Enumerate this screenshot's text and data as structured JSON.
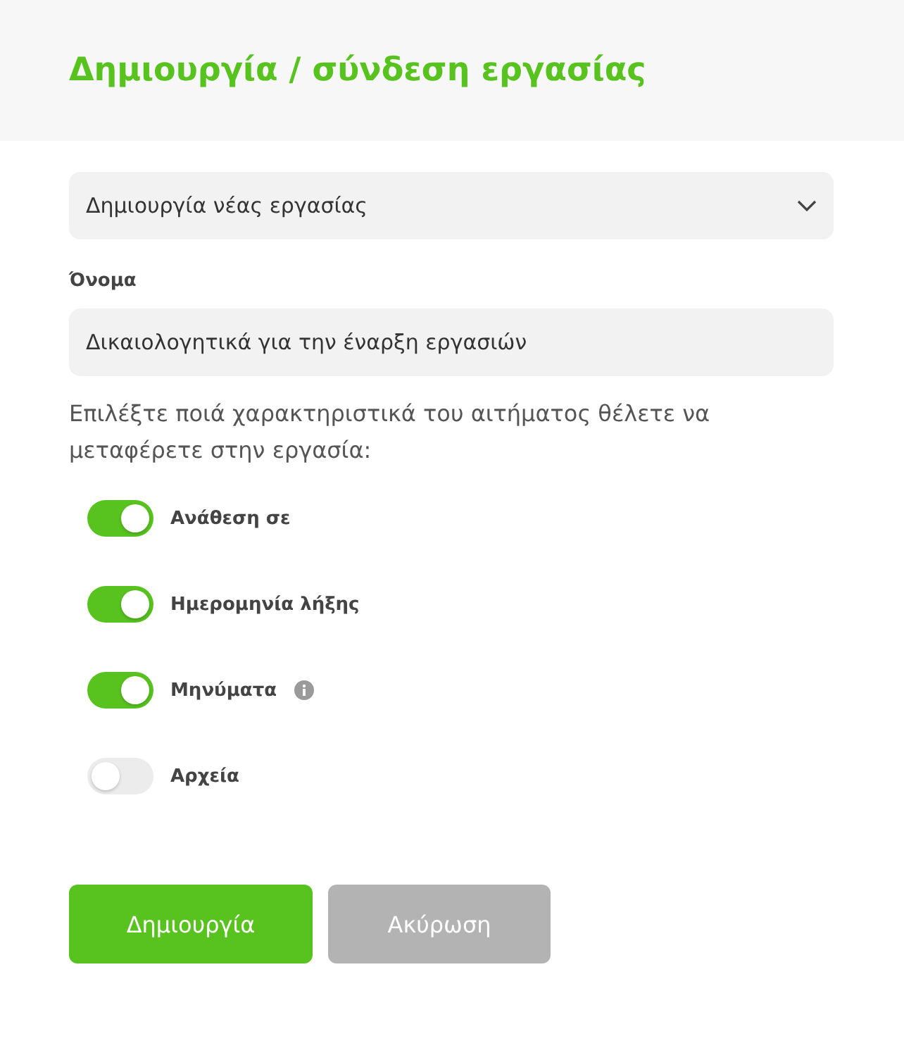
{
  "dialog": {
    "title": "Δημιουργία / σύνδεση εργασίας"
  },
  "mode_select": {
    "value": "Δημιουργία νέας εργασίας"
  },
  "name_field": {
    "label": "Όνομα",
    "value": "Δικαιολογητικά για την έναρξη εργασιών"
  },
  "instructions": "Επιλέξτε ποιά χαρακτηριστικά του αιτήματος θέλετε να μεταφέρετε στην εργασία:",
  "toggles": [
    {
      "label": "Ανάθεση σε",
      "on": true,
      "info": false
    },
    {
      "label": "Ημερομηνία λήξης",
      "on": true,
      "info": false
    },
    {
      "label": "Μηνύματα",
      "on": true,
      "info": true
    },
    {
      "label": "Αρχεία",
      "on": false,
      "info": false
    }
  ],
  "buttons": [
    {
      "label": "Δημιουργία",
      "kind": "primary"
    },
    {
      "label": "Ακύρωση",
      "kind": "secondary"
    }
  ]
}
